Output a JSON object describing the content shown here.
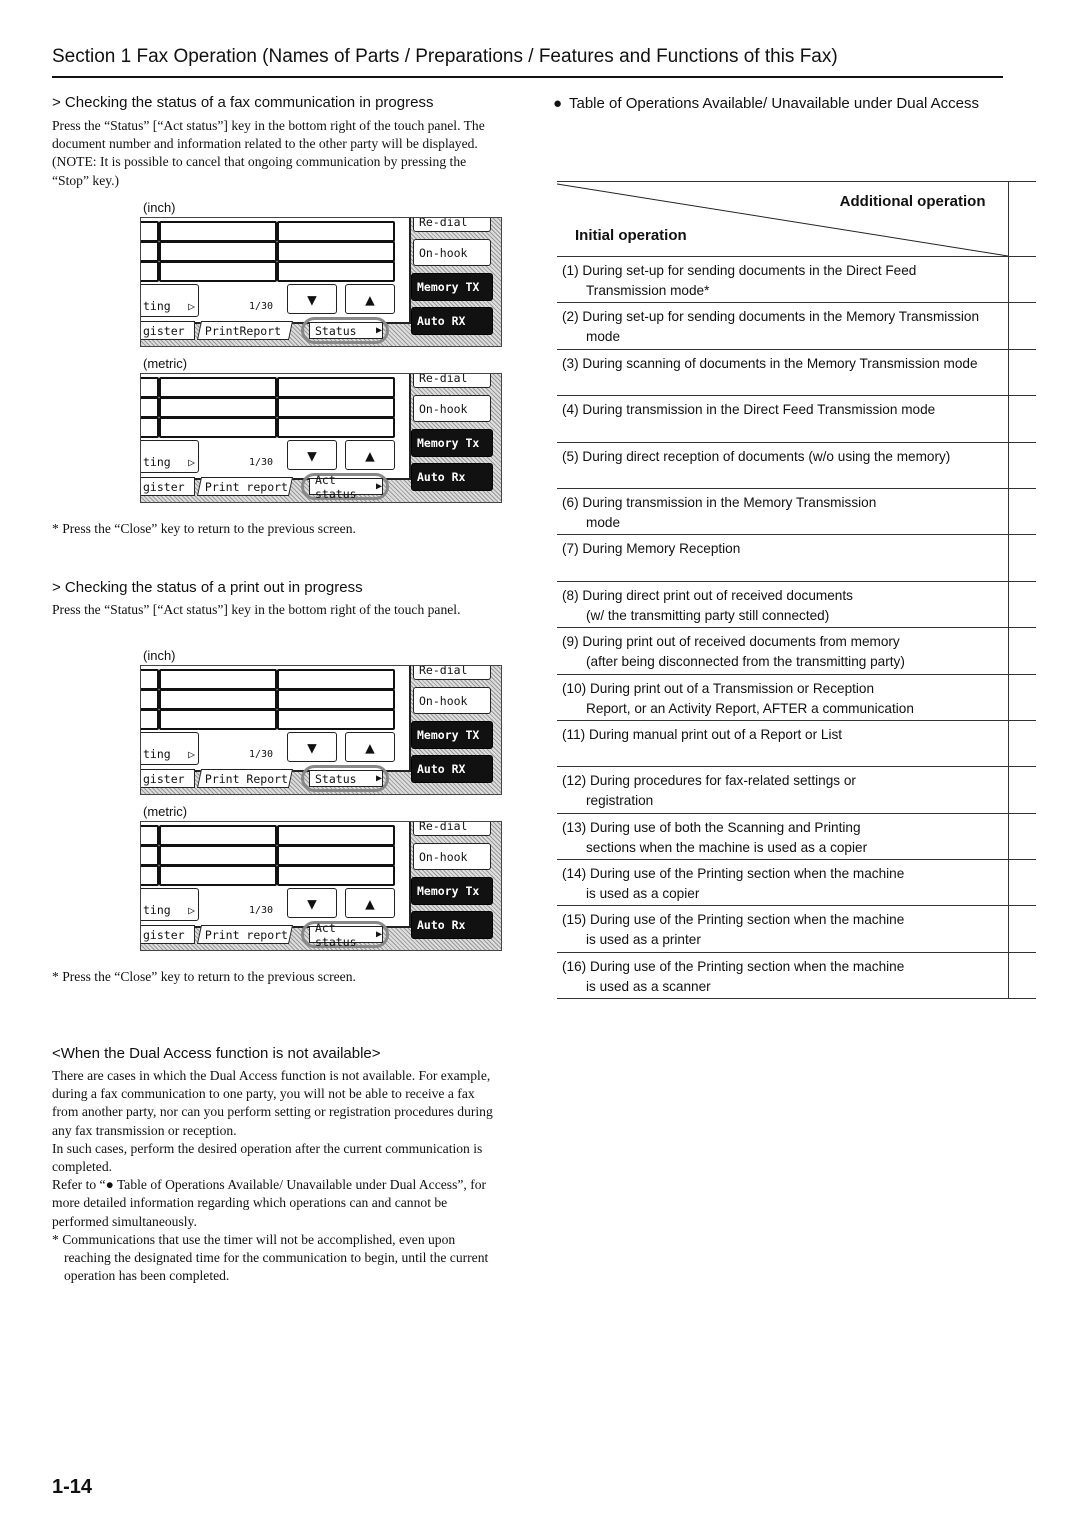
{
  "header": {
    "title": "Section 1  Fax Operation (Names of Parts / Preparations / Features and Functions of this Fax)"
  },
  "left": {
    "s1": {
      "heading": "> Checking the status of a fax communication in progress",
      "body": "Press the “Status” [“Act status”] key in the bottom right of the touch panel. The document number and information related to the other party will be displayed. (NOTE: It is possible to cancel that ongoing communication by pressing the “Stop” key.)",
      "note": "*  Press the “Close” key to return to the previous screen."
    },
    "s2": {
      "heading": "> Checking the status of a print out in progress",
      "body": "Press the “Status” [“Act status”] key in the bottom right of the touch panel.",
      "note": "*  Press the “Close” key to return to the previous screen."
    },
    "panels": [
      {
        "caption": "(inch)",
        "redial": "Re-dial",
        "onhook": "On-hook",
        "memtx": "Memory TX",
        "autorx": "Auto RX",
        "ting": "ting",
        "page": "1/30",
        "register": "gister",
        "print": "PrintReport",
        "status": "Status"
      },
      {
        "caption": "(metric)",
        "redial": "Re-dial",
        "onhook": "On-hook",
        "memtx": "Memory Tx",
        "autorx": "Auto Rx",
        "ting": "ting",
        "page": "1/30",
        "register": "gister",
        "print": "Print report",
        "status": "Act status"
      },
      {
        "caption": "(inch)",
        "redial": "Re-dial",
        "onhook": "On-hook",
        "memtx": "Memory TX",
        "autorx": "Auto RX",
        "ting": "ting",
        "page": "1/30",
        "register": "gister",
        "print": "Print Report",
        "status": "Status"
      },
      {
        "caption": "(metric)",
        "redial": "Re-dial",
        "onhook": "On-hook",
        "memtx": "Memory Tx",
        "autorx": "Auto Rx",
        "ting": "ting",
        "page": "1/30",
        "register": "gister",
        "print": "Print report",
        "status": "Act status"
      }
    ],
    "s3": {
      "heading": "<When the Dual Access function is not available>",
      "p1": "There are cases in which the Dual Access function is not available. For example, during a fax communication to one party, you will not be able to receive a fax from another party, nor can you perform setting or registration procedures during any fax transmission or reception.",
      "p2": "In such cases, perform the desired operation after the current communication is completed.",
      "p3": "Refer to “● Table of Operations Available/ Unavailable under Dual Access”, for more detailed information regarding which operations can and cannot be performed simultaneously.",
      "p4": "*  Communications that use the timer will not be accomplished, even upon reaching the designated time for the communication to begin, until the current operation has been completed."
    }
  },
  "right": {
    "heading": "Table of Operations Available/ Unavailable under Dual Access",
    "table": {
      "col_header": "Additional operation",
      "row_header": "Initial operation",
      "rows": [
        [
          "(1) During set-up for sending documents in the Direct Feed",
          "Transmission mode*"
        ],
        [
          "(2) During set-up for sending documents in the Memory Transmission",
          "mode"
        ],
        [
          "(3) During scanning of documents in the Memory Transmission mode",
          ""
        ],
        [
          "(4) During transmission in the Direct Feed Transmission mode",
          ""
        ],
        [
          "(5) During direct reception of documents (w/o using the memory)",
          ""
        ],
        [
          "(6) During transmission in the Memory Transmission",
          "mode"
        ],
        [
          "(7) During Memory Reception",
          ""
        ],
        [
          "(8) During direct print out of received documents",
          "(w/ the transmitting party still connected)"
        ],
        [
          "(9) During print out of received documents from memory",
          "(after being disconnected from the transmitting party)"
        ],
        [
          "(10) During print out of a Transmission or Reception",
          "Report, or an Activity Report, AFTER a communication"
        ],
        [
          "(11) During manual print out of a Report or List",
          ""
        ],
        [
          "(12) During procedures for fax-related settings or",
          "registration"
        ],
        [
          "(13) During use of both the Scanning and Printing",
          "sections when the machine is used as a copier"
        ],
        [
          "(14) During use of the Printing section when the machine",
          "is used as a copier"
        ],
        [
          "(15) During use of the Printing section when the machine",
          "is used as a printer"
        ],
        [
          "(16) During use of the Printing section when the machine",
          "is used as a scanner"
        ]
      ]
    }
  },
  "footer": {
    "page_number": "1-14"
  }
}
